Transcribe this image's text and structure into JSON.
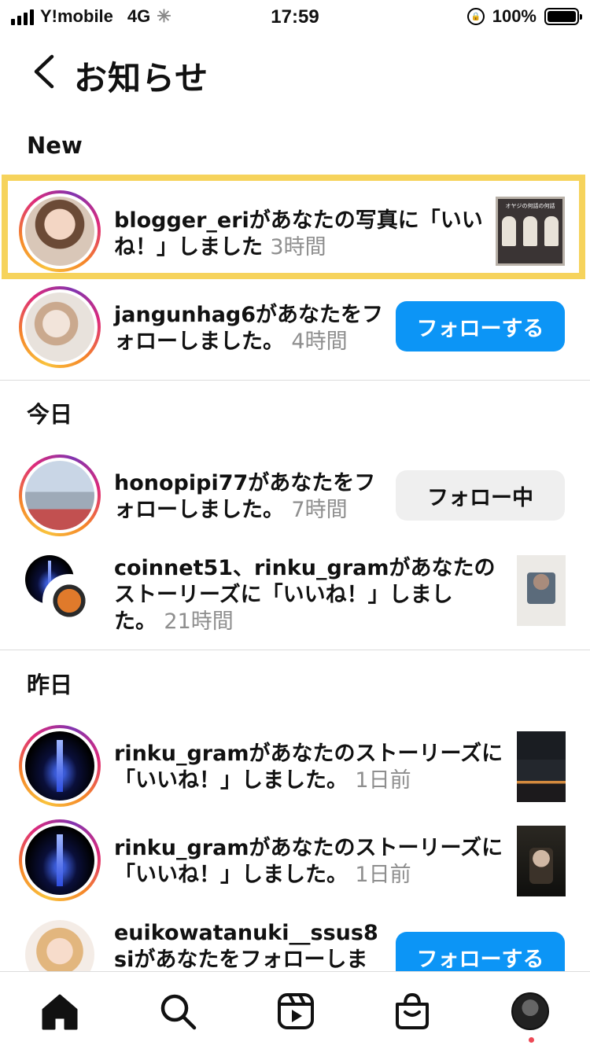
{
  "status_bar": {
    "carrier": "Y!mobile",
    "network": "4G",
    "time": "17:59",
    "battery": "100%"
  },
  "header": {
    "title": "お知らせ",
    "back_icon": "chevron-left-icon"
  },
  "sections": {
    "new": "New",
    "today": "今日",
    "yesterday": "昨日"
  },
  "notifications": [
    {
      "user": "blogger_eri",
      "message": "があなたの写真に「いいね！」しました",
      "time": "3時間",
      "line1": "blogger_eriがあなたの写真に「いい",
      "line2a": "ね！」しました",
      "highlighted": true
    },
    {
      "user": "jangunhag6",
      "line1b": "があなたをフ",
      "line2a": "ォローしました。",
      "time": "4時間",
      "button": "フォローする"
    },
    {
      "user": "honopipi77",
      "line1b": "があなたをフ",
      "line2a": "ォローしました。",
      "time": "7時間",
      "button": "フォロー中"
    },
    {
      "user": "coinnet51、rinku_gram",
      "line1b": "があなたの",
      "line2": "ストーリーズに「いいね！」しまし",
      "line3a": "た。",
      "time": "21時間"
    },
    {
      "user": "rinku_gram",
      "line1b": "があなたのストーリーズに",
      "line2a": "「いいね！」しました。",
      "time": "1日前"
    },
    {
      "user": "rinku_gram",
      "line1b": "があなたのストーリーズに",
      "line2a": "「いいね！」しました。",
      "time": "1日前"
    },
    {
      "user": "euikowatanuki__ssus8",
      "line2a": "si",
      "line2b": "があなたをフォローしま",
      "button": "フォローする"
    }
  ],
  "tab_bar": {
    "items": [
      "home-icon",
      "search-icon",
      "reels-icon",
      "shop-icon",
      "profile-avatar"
    ]
  },
  "colors": {
    "accent": "#0c95f6",
    "highlight": "#f6d35c",
    "notification_dot": "#ed4956"
  }
}
